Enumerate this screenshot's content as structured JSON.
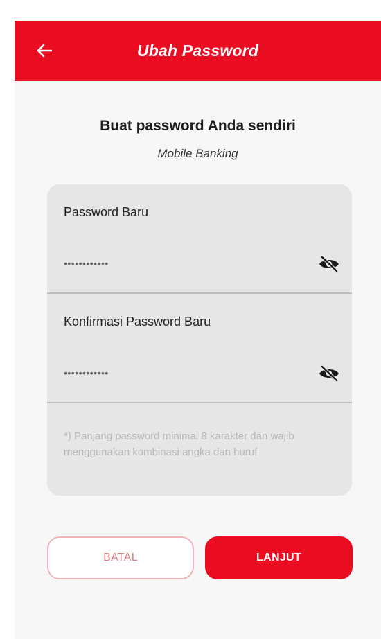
{
  "header": {
    "title": "Ubah Password",
    "back_icon": "arrow-left-icon"
  },
  "intro": {
    "heading": "Buat password Anda sendiri",
    "subheading": "Mobile Banking"
  },
  "form": {
    "new_password": {
      "label": "Password Baru",
      "value": "••••••••••••",
      "toggle_icon": "eye-slash-icon"
    },
    "confirm_password": {
      "label": "Konfirmasi Password Baru",
      "value": "••••••••••••",
      "toggle_icon": "eye-slash-icon"
    },
    "note": "*) Panjang password minimal 8 karakter dan wajib menggunakan kombinasi angka dan huruf"
  },
  "actions": {
    "cancel_label": "BATAL",
    "next_label": "LANJUT"
  },
  "colors": {
    "primary": "#ea0d22",
    "card": "#e6e6e6",
    "note_text": "#b8b8b8"
  }
}
